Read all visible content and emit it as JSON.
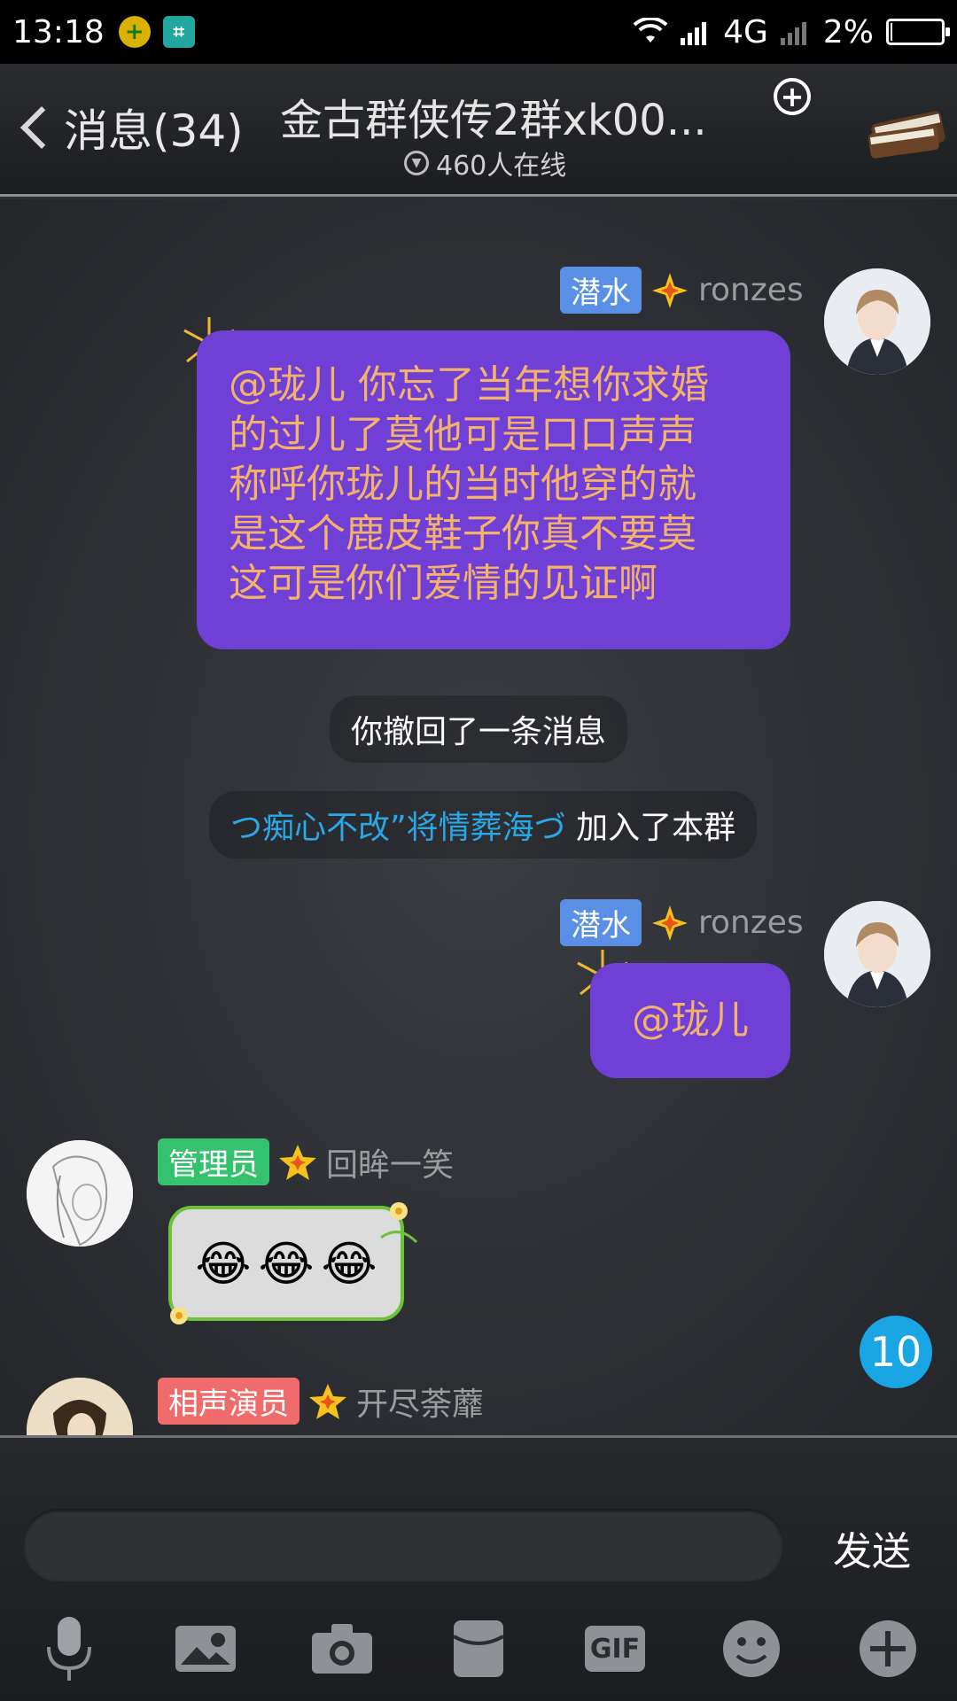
{
  "status_bar": {
    "time": "13:18",
    "network": "4G",
    "battery": "2%",
    "battery_level": 0.02
  },
  "header": {
    "back_label": "消息(34)",
    "group_name": "金古群侠传2群xk00...",
    "online_status": "460人在线",
    "add_icon": "plus-circle-icon",
    "menu_icon": "book-icon"
  },
  "messages": [
    {
      "sender_badge": "潜水",
      "sender_name": "ronzes",
      "text": "@珑儿 你忘了当年想你求婚的过儿了莫他可是口口声声称呼你珑儿的当时他穿的就是这个鹿皮鞋子你真不要莫这可是你们爱情的见证啊",
      "lines": [
        "@珑儿 你忘了当年想你求婚",
        "的过儿了莫他可是口口声声",
        "称呼你珑儿的当时他穿的就",
        "是这个鹿皮鞋子你真不要莫",
        "这可是你们爱情的见证啊"
      ]
    },
    {
      "system": "你撤回了一条消息"
    },
    {
      "system_join_name": "つ痴心不改”将情葬海づ",
      "system_join_text": " 加入了本群"
    },
    {
      "sender_badge": "潜水",
      "sender_name": "ronzes",
      "text": "@珑儿"
    },
    {
      "sender_badge": "管理员",
      "sender_name": "回眸一笑",
      "emoji": [
        "😂",
        "😂",
        "😂"
      ]
    },
    {
      "sender_badge": "相声演员",
      "sender_name": "开尽荼蘼"
    }
  ],
  "unread_count": "10",
  "input": {
    "placeholder": "",
    "send_label": "发送"
  },
  "toolbar": {
    "gif_label": "GIF",
    "icons": [
      "microphone-icon",
      "image-icon",
      "camera-icon",
      "red-packet-icon",
      "gif-icon",
      "emoji-icon",
      "plus-icon"
    ]
  },
  "colors": {
    "badge_diving": "#5a8fe6",
    "badge_admin": "#35c26f",
    "badge_comedian": "#f06b6b",
    "bubble_purple": "#6f3fd6",
    "bubble_text": "#f2b26a",
    "link_blue": "#2aa8e6",
    "unread_blue": "#1aa5e4"
  }
}
